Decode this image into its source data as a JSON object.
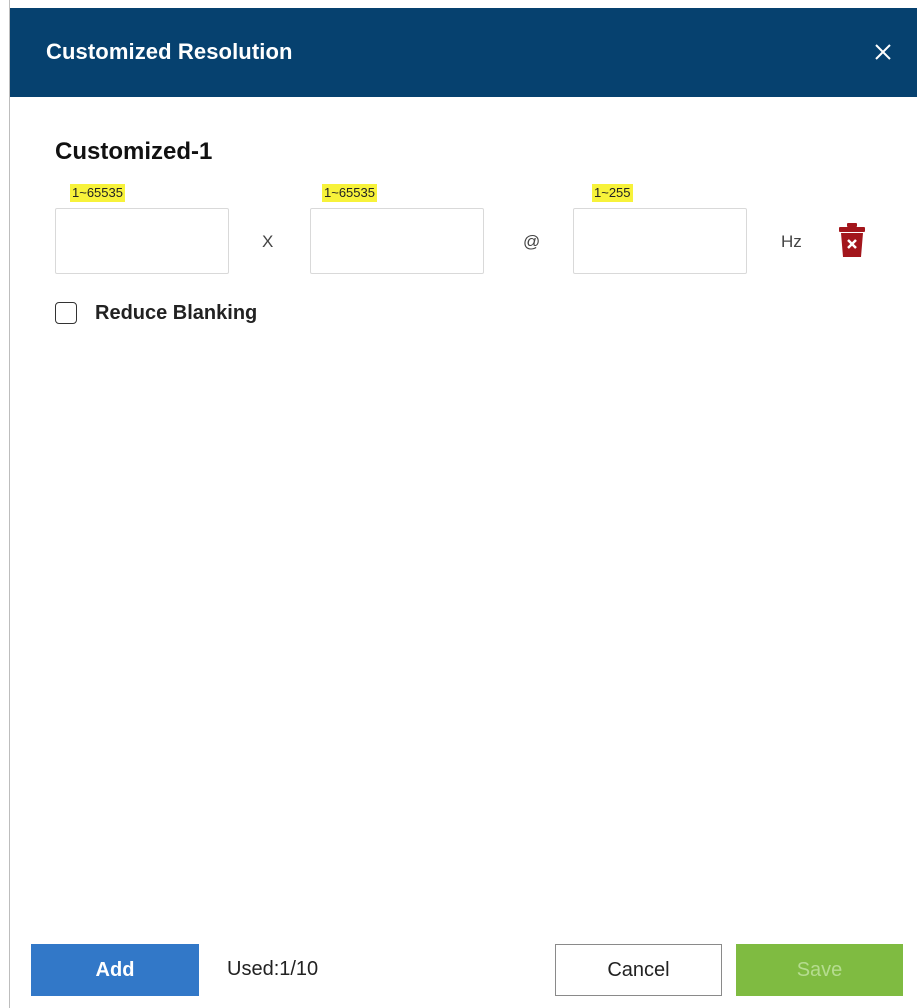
{
  "dialog": {
    "title": "Customized Resolution",
    "close_icon": "close-icon",
    "header_color": "#06416f"
  },
  "entry": {
    "title": "Customized-1",
    "width_hint": "1~65535",
    "height_hint": "1~65535",
    "refresh_hint": "1~255",
    "width_value": "",
    "height_value": "",
    "refresh_value": "",
    "separator_x": "X",
    "separator_at": "@",
    "unit": "Hz",
    "delete_icon": "trash-icon",
    "delete_icon_color": "#a3161c",
    "hint_highlight_color": "#f7f23a"
  },
  "reduce_blanking": {
    "label": "Reduce Blanking",
    "checked": false
  },
  "footer": {
    "add_label": "Add",
    "used_text": "Used:1/10",
    "cancel_label": "Cancel",
    "save_label": "Save",
    "add_color": "#3278c8",
    "save_color": "#7fbb41"
  }
}
